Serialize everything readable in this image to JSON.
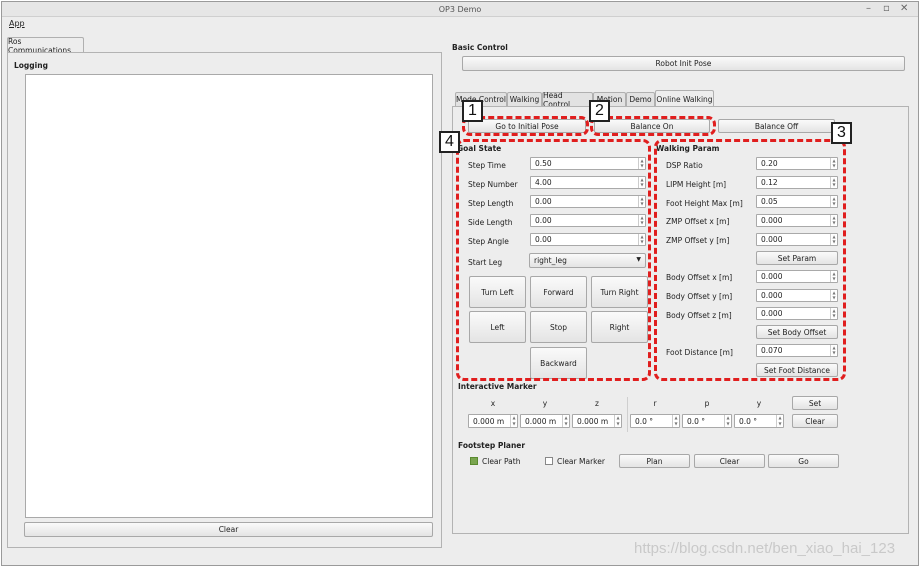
{
  "window": {
    "title": "OP3 Demo",
    "minimize": "–",
    "maximize": "▫",
    "close": "✕"
  },
  "menu": {
    "app": "App"
  },
  "left": {
    "tab": "Ros Communications",
    "logging_title": "Logging",
    "clear": "Clear"
  },
  "right": {
    "basic_control": "Basic Control",
    "robot_init_pose": "Robot Init Pose",
    "tabs": [
      "Mode Control",
      "Walking",
      "Head Control",
      "Motion",
      "Demo",
      "Online Walking"
    ],
    "go_initial_pose": "Go to Initial Pose",
    "balance_on": "Balance On",
    "balance_off": "Balance Off",
    "badges": [
      "1",
      "2",
      "3",
      "4"
    ],
    "goal": {
      "title": "Goal State",
      "rows": [
        {
          "label": "Step Time",
          "value": "0.50"
        },
        {
          "label": "Step Number",
          "value": "4.00"
        },
        {
          "label": "Step Length",
          "value": "0.00"
        },
        {
          "label": "Side Length",
          "value": "0.00"
        },
        {
          "label": "Step Angle",
          "value": "0.00"
        }
      ],
      "start_leg_label": "Start Leg",
      "start_leg_value": "right_leg",
      "buttons": {
        "turn_left": "Turn Left",
        "forward": "Forward",
        "turn_right": "Turn Right",
        "left": "Left",
        "stop": "Stop",
        "right": "Right",
        "backward": "Backward"
      }
    },
    "walking": {
      "title": "Walking Param",
      "rows1": [
        {
          "label": "DSP Ratio",
          "value": "0.20"
        },
        {
          "label": "LIPM Height [m]",
          "value": "0.12"
        },
        {
          "label": "Foot Height Max [m]",
          "value": "0.05"
        },
        {
          "label": "ZMP Offset x [m]",
          "value": "0.000"
        },
        {
          "label": "ZMP Offset y [m]",
          "value": "0.000"
        }
      ],
      "set_param": "Set Param",
      "rows2": [
        {
          "label": "Body Offset x [m]",
          "value": "0.000"
        },
        {
          "label": "Body Offset y [m]",
          "value": "0.000"
        },
        {
          "label": "Body Offset z [m]",
          "value": "0.000"
        }
      ],
      "set_body_offset": "Set Body Offset",
      "foot_distance_label": "Foot Distance [m]",
      "foot_distance_value": "0.070",
      "set_foot_distance": "Set Foot Distance"
    },
    "marker": {
      "title": "Interactive Marker",
      "headers": [
        "x",
        "y",
        "z",
        "r",
        "p",
        "y"
      ],
      "values": [
        "0.000 m",
        "0.000 m",
        "0.000 m",
        "0.0 °",
        "0.0 °",
        "0.0 °"
      ],
      "set": "Set",
      "clear": "Clear"
    },
    "footstep": {
      "title": "Footstep Planer",
      "clear_path": "Clear Path",
      "clear_marker": "Clear Marker",
      "plan": "Plan",
      "clear": "Clear",
      "go": "Go"
    }
  },
  "watermark": "https://blog.csdn.net/ben_xiao_hai_123"
}
